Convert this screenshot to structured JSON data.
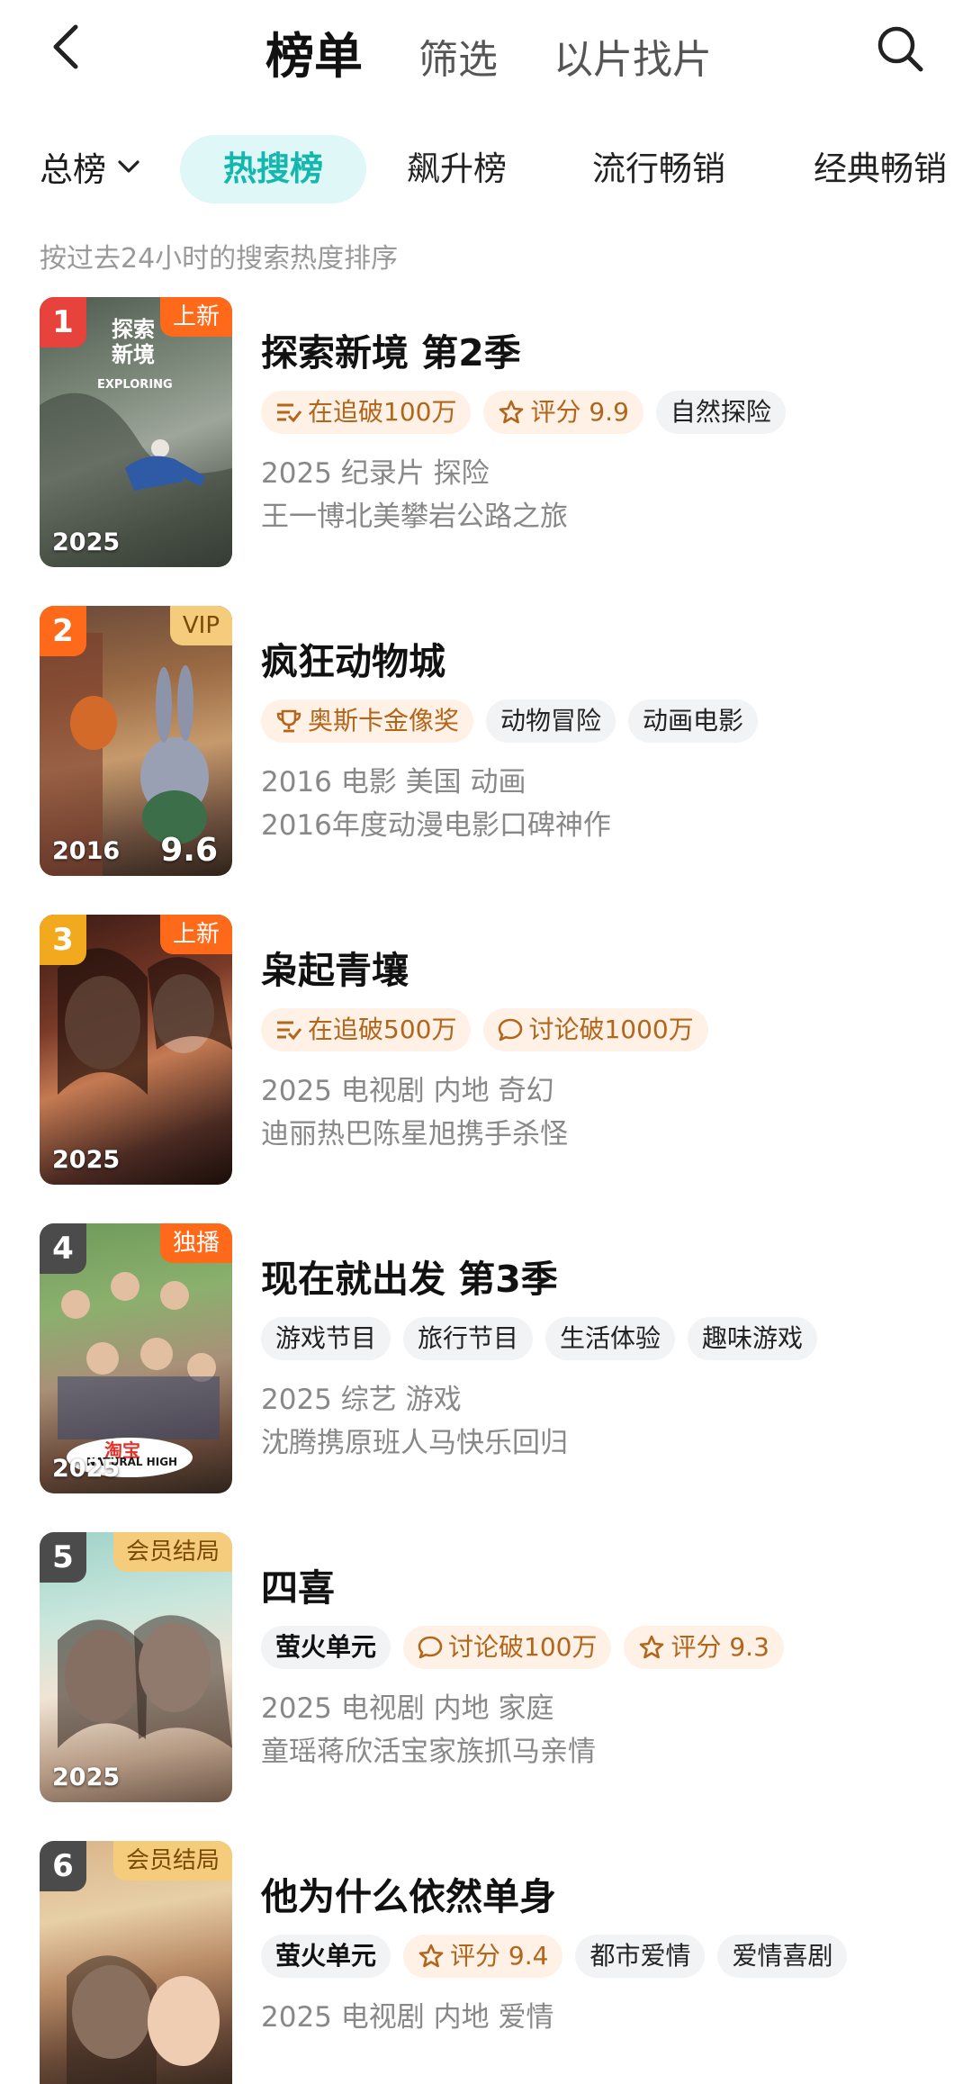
{
  "nav": {
    "tabs": [
      {
        "label": "榜单",
        "active": true
      },
      {
        "label": "筛选",
        "active": false
      },
      {
        "label": "以片找片",
        "active": false
      }
    ]
  },
  "categories": {
    "first": "总榜",
    "items": [
      "热搜榜",
      "飙升榜",
      "流行畅销",
      "经典畅销"
    ],
    "active": "热搜榜"
  },
  "subtitle": "按过去24小时的搜索热度排序",
  "colors": {
    "accent": "#12b7ad",
    "rank1": "#e8423c",
    "rank2": "#ff6a1a",
    "rank3": "#f3a91e",
    "rank_other": "#4b4b4b",
    "highlight_tag": "#b1661c"
  },
  "items": [
    {
      "rank": "1",
      "badge": "上新",
      "year": "2025",
      "title": "探索新境 第2季",
      "tags": [
        {
          "icon": "follow-list-icon",
          "text": "在追破100万"
        },
        {
          "icon": "star-outline-icon",
          "text": "评分 9.9"
        },
        {
          "text": "自然探险"
        }
      ],
      "meta": "2025 纪录片 探险",
      "desc": "王一博北美攀岩公路之旅",
      "poster_text": [
        "探索",
        "新境",
        "EXPLORING"
      ]
    },
    {
      "rank": "2",
      "badge": "VIP",
      "year": "2016",
      "score": "9.6",
      "title": "疯狂动物城",
      "tags": [
        {
          "icon": "trophy-icon",
          "text": "奥斯卡金像奖"
        },
        {
          "text": "动物冒险"
        },
        {
          "text": "动画电影"
        }
      ],
      "meta": "2016 电影 美国 动画",
      "desc": "2016年度动漫电影口碑神作"
    },
    {
      "rank": "3",
      "badge": "上新",
      "year": "2025",
      "title": "枭起青壤",
      "tags": [
        {
          "icon": "follow-list-icon",
          "text": "在追破500万"
        },
        {
          "icon": "chat-bubble-icon",
          "text": "讨论破1000万"
        }
      ],
      "meta": "2025 电视剧 内地 奇幻",
      "desc": "迪丽热巴陈星旭携手杀怪"
    },
    {
      "rank": "4",
      "badge": "独播",
      "year": "2025",
      "title": "现在就出发 第3季",
      "tags": [
        {
          "text": "游戏节目"
        },
        {
          "text": "旅行节目"
        },
        {
          "text": "生活体验"
        },
        {
          "text": "趣味游戏"
        }
      ],
      "meta": "2025 综艺 游戏",
      "desc": "沈腾携原班人马快乐回归",
      "poster_text": [
        "淘宝",
        "NATURAL HIGH"
      ]
    },
    {
      "rank": "5",
      "badge": "会员结局",
      "year": "2025",
      "title": "四喜",
      "tags": [
        {
          "brand": true,
          "text": "萤火单元"
        },
        {
          "icon": "chat-bubble-icon",
          "text": "讨论破100万"
        },
        {
          "icon": "star-outline-icon",
          "text": "评分 9.3"
        }
      ],
      "meta": "2025 电视剧 内地 家庭",
      "desc": "童瑶蒋欣活宝家族抓马亲情"
    },
    {
      "rank": "6",
      "badge": "会员结局",
      "title": "他为什么依然单身",
      "tags": [
        {
          "brand": true,
          "text": "萤火单元"
        },
        {
          "icon": "star-outline-icon",
          "text": "评分 9.4"
        },
        {
          "text": "都市爱情"
        },
        {
          "text": "爱情喜剧"
        }
      ],
      "meta": "2025 电视剧 内地 爱情"
    }
  ]
}
